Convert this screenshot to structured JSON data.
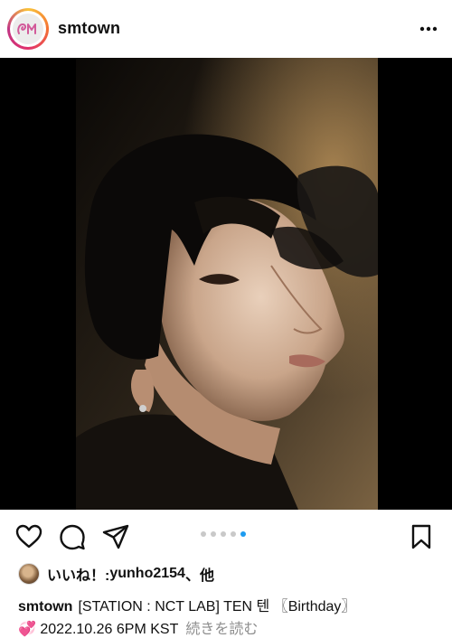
{
  "header": {
    "username": "smtown",
    "avatar_icon": "smtown-logo-icon",
    "more_icon": "more-horizontal-icon"
  },
  "post": {
    "photo_icon": "portrait-photo",
    "carousel": {
      "count": 5,
      "active_index": 4
    }
  },
  "actions": {
    "like_icon": "heart-icon",
    "comment_icon": "comment-icon",
    "share_icon": "send-icon",
    "save_icon": "bookmark-icon"
  },
  "likes": {
    "prefix": "いいね！: ",
    "user": "yunho2154",
    "suffix": "、他"
  },
  "caption": {
    "user": "smtown",
    "text": "[STATION : NCT LAB] TEN 텐 〖Birthday〗",
    "line2": "💞 2022.10.26 6PM KST",
    "more_label": "続きを読む"
  }
}
